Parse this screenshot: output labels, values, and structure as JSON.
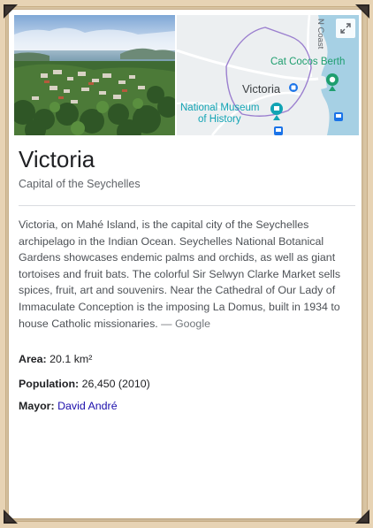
{
  "place": {
    "title": "Victoria",
    "subtitle": "Capital of the Seychelles",
    "description": "Victoria, on Mahé Island, is the capital city of the Seychelles archipelago in the Indian Ocean. Seychelles National Botanical Gardens showcases endemic palms and orchids, as well as giant tortoises and fruit bats. The colorful Sir Selwyn Clarke Market sells spices, fruit, art and souvenirs. Near the Cathedral of Our Lady of Immaculate Conception is the imposing La Domus, built in 1934 to house Catholic missionaries.",
    "description_source": "— Google"
  },
  "map": {
    "labels": {
      "city": "Victoria",
      "berth": "Cat Cocos Berth",
      "museum_line1": "National Museum",
      "museum_line2": "of History",
      "road": "N Coast"
    },
    "colors": {
      "water": "#a6d0e4",
      "land": "#eceff1",
      "boundary": "#9b7fcf",
      "poi_green": "#1e9e6f",
      "poi_teal": "#12a4b4",
      "transit_blue": "#1a73e8"
    }
  },
  "facts": [
    {
      "label": "Area:",
      "value": "20.1 km²"
    },
    {
      "label": "Population:",
      "value": "26,450 (2010)"
    },
    {
      "label": "Mayor:",
      "value": "David André"
    }
  ],
  "colors": {
    "background": "#e7d3b4",
    "link": "#1a0dab",
    "title": "#202124",
    "subtitle": "#5f6368",
    "body_text": "#4d5156"
  },
  "icons": {
    "expand": "expand-icon",
    "museum": "museum-pin-icon",
    "ferry": "ferry-pin-icon",
    "bus": "bus-stop-icon",
    "corner": "photo-corner-icon"
  }
}
